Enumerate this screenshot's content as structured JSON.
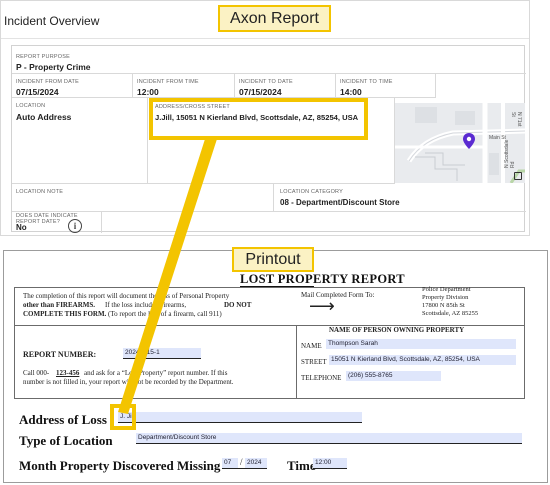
{
  "axon": {
    "panel_title": "Incident Overview",
    "report_purpose_label": "REPORT PURPOSE",
    "report_purpose": "P - Property Crime",
    "from_date_label": "INCIDENT FROM DATE",
    "from_date": "07/15/2024",
    "from_time_label": "INCIDENT FROM TIME",
    "from_time": "12:00",
    "to_date_label": "INCIDENT TO DATE",
    "to_date": "07/15/2024",
    "to_time_label": "INCIDENT TO TIME",
    "to_time": "14:00",
    "location_label": "LOCATION",
    "location": "Auto Address",
    "address_label": "ADDRESS/CROSS STREET",
    "address": "J.Jill, 15051 N Kierland Blvd, Scottsdale, AZ, 85254, USA",
    "location_note_label": "LOCATION NOTE",
    "location_category_label": "LOCATION CATEGORY",
    "location_category": "08 - Department/Discount Store",
    "does_date_label_1": "DOES DATE INDICATE",
    "does_date_label_2": "REPORT DATE?",
    "does_date_value": "No",
    "info_icon": "i",
    "map_street_1": "Main St",
    "map_street_2": "N 71st St",
    "map_street_3": "N Scottsdale Rd"
  },
  "callouts": {
    "axon": "Axon Report",
    "printout": "Printout"
  },
  "printout": {
    "title": "LOST PROPERTY REPORT",
    "intro_1": "The completion of this report will document the loss of Personal Property",
    "intro_2_a": "other than FIREARMS.",
    "intro_2_b": "If the loss includes Firearms,",
    "intro_2_c": "DO NOT",
    "intro_3_a": "COMPLETE THIS FORM.",
    "intro_3_b": "(To report the loss of a firearm, call 911)",
    "mail_label": "Mail Completed Form To:",
    "arrow": "⟶",
    "dept_line_1": "Police Department",
    "dept_line_2": "Property Division",
    "dept_line_3": "17800 N 85th St",
    "dept_line_4": "Scottsdale, AZ 85255",
    "owner_header": "NAME OF PERSON OWNING PROPERTY",
    "name_label": "NAME",
    "name_value": "Thompson Sarah",
    "street_label": "STREET",
    "street_value": "15051 N Kierland Blvd, Scottsdale, AZ, 85254, USA",
    "telephone_label": "TELEPHONE",
    "telephone_value": "(206) 555-8765",
    "report_number_label": "REPORT NUMBER:",
    "report_number_value": "20240715-1",
    "call_line_1_a": "Call 000-",
    "call_line_1_b": "123-456",
    "call_line_1_c": "and ask for a “Lost Property” report number.  If this",
    "call_line_2": "number is not filled in, your report will not be recorded by the Department.",
    "address_of_loss_label": "Address of Loss",
    "address_of_loss_value": "J. Jill",
    "type_of_location_label": "Type of Location",
    "type_of_location_value": "Department/Discount Store",
    "month_missing_label": "Month Property Discovered Missing",
    "month_value": "07",
    "slash": "/",
    "year_value": "2024",
    "time_label": "Time",
    "time_value": "12:00"
  },
  "colors": {
    "highlight": "#f3c400",
    "callout_bg": "#fbf2c4",
    "field_fill": "#dfe6fb",
    "map_pin": "#5b2bd1"
  }
}
